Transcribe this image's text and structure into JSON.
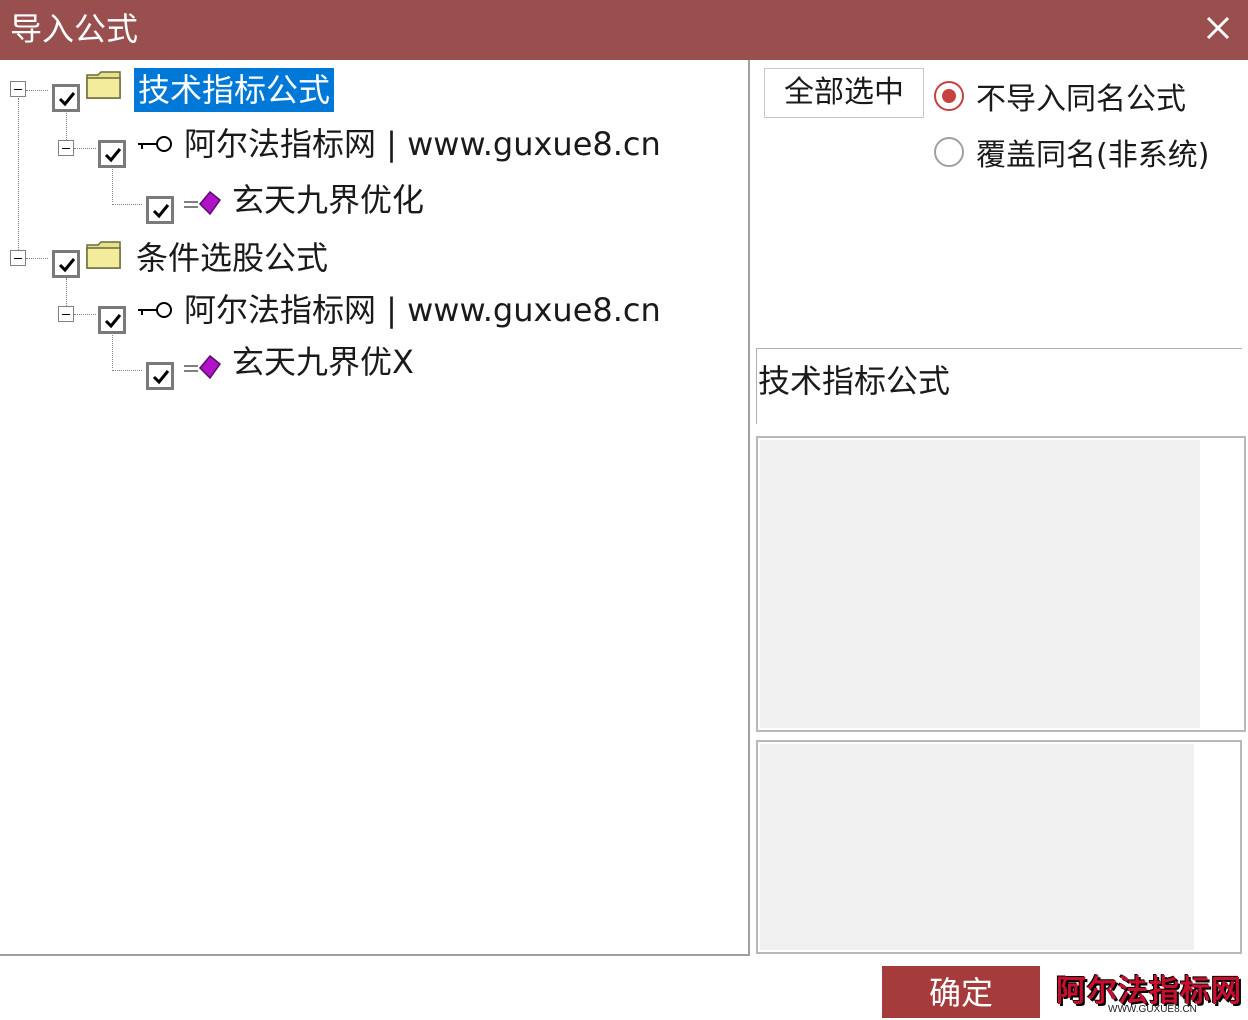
{
  "window": {
    "title": "导入公式"
  },
  "tree": {
    "nodes": [
      {
        "label": "技术指标公式"
      },
      {
        "label": "阿尔法指标网 | www.guxue8.cn"
      },
      {
        "label": "玄天九界优化"
      },
      {
        "label": "条件选股公式"
      },
      {
        "label": "阿尔法指标网 | www.guxue8.cn"
      },
      {
        "label": "玄天九界优X"
      }
    ]
  },
  "right": {
    "select_all_label": "全部选中",
    "radio_options": [
      {
        "label": "不导入同名公式",
        "checked": true
      },
      {
        "label": "覆盖同名(非系统)",
        "checked": false
      }
    ],
    "group_title": "技术指标公式"
  },
  "footer": {
    "ok_label": "确定",
    "watermark_text": "阿尔法指标网",
    "watermark_sub": "WWW.GUXUE8.CN"
  },
  "colors": {
    "titlebar": "#9a4f4f",
    "ok_button": "#a63b3b",
    "selection": "#0078d7"
  }
}
